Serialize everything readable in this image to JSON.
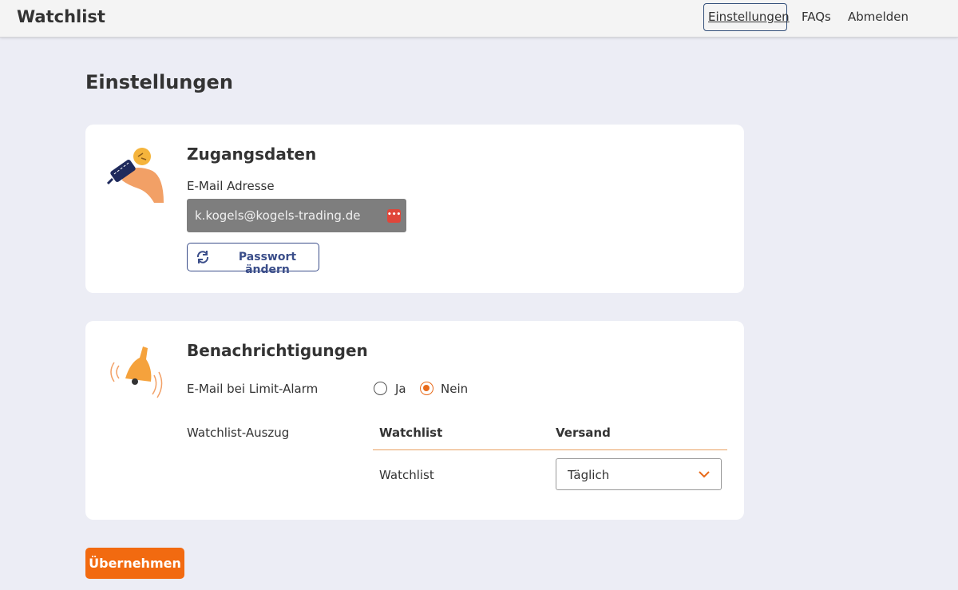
{
  "app": {
    "title": "Watchlist"
  },
  "nav": {
    "items": [
      "Einstellungen",
      "FAQs",
      "Abmelden"
    ]
  },
  "page": {
    "title": "Einstellungen"
  },
  "access": {
    "heading": "Zugangsdaten",
    "email_label": "E-Mail Adresse",
    "email_value": "k.kogels@kogels-trading.de",
    "password_button": "Passwort ändern",
    "password_manager_icon": "•••"
  },
  "notifications": {
    "heading": "Benachrichtigungen",
    "limit_alarm_label": "E-Mail bei Limit-Alarm",
    "options": [
      "Ja",
      "Nein"
    ],
    "selected": "Nein",
    "digest_label": "Watchlist-Auszug",
    "table": {
      "headers": [
        "Watchlist",
        "Versand"
      ],
      "rows": [
        {
          "watchlist": "Watchlist",
          "versand": "Täglich"
        }
      ]
    }
  },
  "actions": {
    "apply_label": "Übernehmen"
  },
  "colors": {
    "accent": "#f26a10",
    "primary": "#3b4e8a",
    "background": "#ecedf5"
  }
}
